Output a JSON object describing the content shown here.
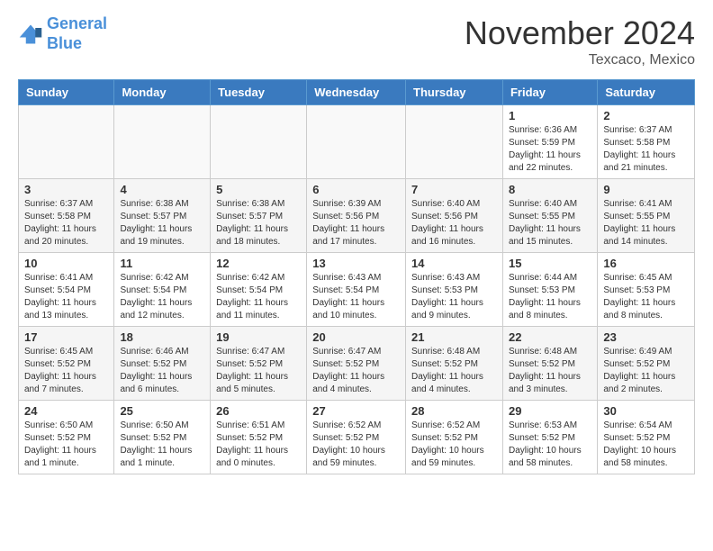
{
  "header": {
    "logo_line1": "General",
    "logo_line2": "Blue",
    "month": "November 2024",
    "location": "Texcaco, Mexico"
  },
  "weekdays": [
    "Sunday",
    "Monday",
    "Tuesday",
    "Wednesday",
    "Thursday",
    "Friday",
    "Saturday"
  ],
  "weeks": [
    [
      {
        "day": "",
        "info": ""
      },
      {
        "day": "",
        "info": ""
      },
      {
        "day": "",
        "info": ""
      },
      {
        "day": "",
        "info": ""
      },
      {
        "day": "",
        "info": ""
      },
      {
        "day": "1",
        "info": "Sunrise: 6:36 AM\nSunset: 5:59 PM\nDaylight: 11 hours and 22 minutes."
      },
      {
        "day": "2",
        "info": "Sunrise: 6:37 AM\nSunset: 5:58 PM\nDaylight: 11 hours and 21 minutes."
      }
    ],
    [
      {
        "day": "3",
        "info": "Sunrise: 6:37 AM\nSunset: 5:58 PM\nDaylight: 11 hours and 20 minutes."
      },
      {
        "day": "4",
        "info": "Sunrise: 6:38 AM\nSunset: 5:57 PM\nDaylight: 11 hours and 19 minutes."
      },
      {
        "day": "5",
        "info": "Sunrise: 6:38 AM\nSunset: 5:57 PM\nDaylight: 11 hours and 18 minutes."
      },
      {
        "day": "6",
        "info": "Sunrise: 6:39 AM\nSunset: 5:56 PM\nDaylight: 11 hours and 17 minutes."
      },
      {
        "day": "7",
        "info": "Sunrise: 6:40 AM\nSunset: 5:56 PM\nDaylight: 11 hours and 16 minutes."
      },
      {
        "day": "8",
        "info": "Sunrise: 6:40 AM\nSunset: 5:55 PM\nDaylight: 11 hours and 15 minutes."
      },
      {
        "day": "9",
        "info": "Sunrise: 6:41 AM\nSunset: 5:55 PM\nDaylight: 11 hours and 14 minutes."
      }
    ],
    [
      {
        "day": "10",
        "info": "Sunrise: 6:41 AM\nSunset: 5:54 PM\nDaylight: 11 hours and 13 minutes."
      },
      {
        "day": "11",
        "info": "Sunrise: 6:42 AM\nSunset: 5:54 PM\nDaylight: 11 hours and 12 minutes."
      },
      {
        "day": "12",
        "info": "Sunrise: 6:42 AM\nSunset: 5:54 PM\nDaylight: 11 hours and 11 minutes."
      },
      {
        "day": "13",
        "info": "Sunrise: 6:43 AM\nSunset: 5:54 PM\nDaylight: 11 hours and 10 minutes."
      },
      {
        "day": "14",
        "info": "Sunrise: 6:43 AM\nSunset: 5:53 PM\nDaylight: 11 hours and 9 minutes."
      },
      {
        "day": "15",
        "info": "Sunrise: 6:44 AM\nSunset: 5:53 PM\nDaylight: 11 hours and 8 minutes."
      },
      {
        "day": "16",
        "info": "Sunrise: 6:45 AM\nSunset: 5:53 PM\nDaylight: 11 hours and 8 minutes."
      }
    ],
    [
      {
        "day": "17",
        "info": "Sunrise: 6:45 AM\nSunset: 5:52 PM\nDaylight: 11 hours and 7 minutes."
      },
      {
        "day": "18",
        "info": "Sunrise: 6:46 AM\nSunset: 5:52 PM\nDaylight: 11 hours and 6 minutes."
      },
      {
        "day": "19",
        "info": "Sunrise: 6:47 AM\nSunset: 5:52 PM\nDaylight: 11 hours and 5 minutes."
      },
      {
        "day": "20",
        "info": "Sunrise: 6:47 AM\nSunset: 5:52 PM\nDaylight: 11 hours and 4 minutes."
      },
      {
        "day": "21",
        "info": "Sunrise: 6:48 AM\nSunset: 5:52 PM\nDaylight: 11 hours and 4 minutes."
      },
      {
        "day": "22",
        "info": "Sunrise: 6:48 AM\nSunset: 5:52 PM\nDaylight: 11 hours and 3 minutes."
      },
      {
        "day": "23",
        "info": "Sunrise: 6:49 AM\nSunset: 5:52 PM\nDaylight: 11 hours and 2 minutes."
      }
    ],
    [
      {
        "day": "24",
        "info": "Sunrise: 6:50 AM\nSunset: 5:52 PM\nDaylight: 11 hours and 1 minute."
      },
      {
        "day": "25",
        "info": "Sunrise: 6:50 AM\nSunset: 5:52 PM\nDaylight: 11 hours and 1 minute."
      },
      {
        "day": "26",
        "info": "Sunrise: 6:51 AM\nSunset: 5:52 PM\nDaylight: 11 hours and 0 minutes."
      },
      {
        "day": "27",
        "info": "Sunrise: 6:52 AM\nSunset: 5:52 PM\nDaylight: 10 hours and 59 minutes."
      },
      {
        "day": "28",
        "info": "Sunrise: 6:52 AM\nSunset: 5:52 PM\nDaylight: 10 hours and 59 minutes."
      },
      {
        "day": "29",
        "info": "Sunrise: 6:53 AM\nSunset: 5:52 PM\nDaylight: 10 hours and 58 minutes."
      },
      {
        "day": "30",
        "info": "Sunrise: 6:54 AM\nSunset: 5:52 PM\nDaylight: 10 hours and 58 minutes."
      }
    ]
  ]
}
